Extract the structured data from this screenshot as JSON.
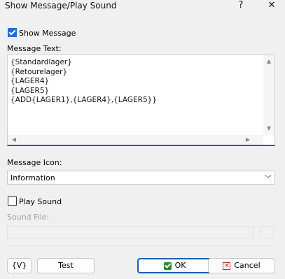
{
  "window": {
    "title": "Show Message/Play Sound",
    "help_glyph": "?",
    "close_glyph": "✕"
  },
  "show_message": {
    "label": "Show Message",
    "checked": true
  },
  "message_text": {
    "label": "Message Text:",
    "value": "{Standardlager}\n{Retourelager}\n{LAGER4}\n{LAGER5}\n{ADD{LAGER1},{LAGER4},{LAGER5}}"
  },
  "message_icon": {
    "label": "Message Icon:",
    "selected": "Information"
  },
  "play_sound": {
    "label": "Play Sound",
    "checked": false
  },
  "sound_file": {
    "label": "Sound File:",
    "value": ""
  },
  "buttons": {
    "variables": "{V}",
    "test": "Test",
    "ok": "OK",
    "cancel": "Cancel"
  },
  "colors": {
    "accent": "#1a5fb4",
    "check_fill": "#1e6fd0",
    "ok_icon": "#2a8a2a",
    "cancel_icon": "#d0302a"
  }
}
